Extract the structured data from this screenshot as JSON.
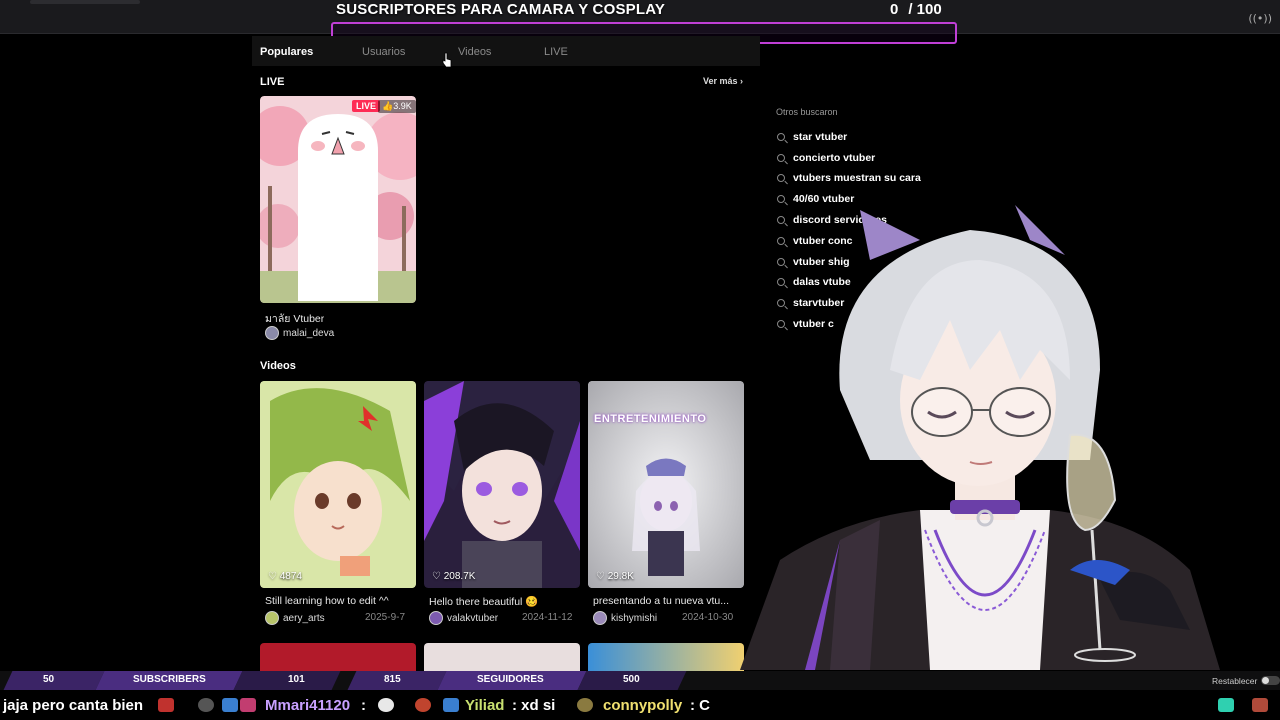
{
  "goal": {
    "title": "SUSCRIPTORES PARA CAMARA Y COSPLAY",
    "current": "0",
    "target": "/ 100",
    "progress": 0,
    "accent": "#c03fd6"
  },
  "tabs": [
    {
      "label": "Populares",
      "active": true
    },
    {
      "label": "Usuarios",
      "active": false
    },
    {
      "label": "Videos",
      "active": false
    },
    {
      "label": "LIVE",
      "active": false
    }
  ],
  "live_section": {
    "title": "LIVE",
    "see_more": "Ver más",
    "card": {
      "badge": "LIVE",
      "likes": "3.9K",
      "caption": "มาลัย Vtuber",
      "author": "malai_deva"
    }
  },
  "videos_section": {
    "title": "Videos",
    "cards": [
      {
        "likes": "4874",
        "caption": "Still learning how to edit ^^",
        "author": "aery_arts",
        "date": "2025-9-7"
      },
      {
        "likes": "208.7K",
        "caption": "Hello there beautiful 🥴",
        "author": "valakvtuber",
        "date": "2024-11-12"
      },
      {
        "likes": "29.8K",
        "caption": "presentando a tu nueva vtu...",
        "author": "kishymishi",
        "date": "2024-10-30",
        "thumb_text": "ENTRETENIMIENTO"
      }
    ]
  },
  "sidebar": {
    "title": "Otros buscaron",
    "items": [
      "star vtuber",
      "concierto vtuber",
      "vtubers muestran su cara",
      "40/60 vtuber",
      "discord servidores",
      "vtuber conc",
      "vtuber shig",
      "dalas vtube",
      "starvtuber",
      "vtuber c"
    ]
  },
  "stats": {
    "subs_left": "50",
    "subs_label": "SUBSCRIBERS",
    "subs_right": "101",
    "follow_left": "815",
    "follow_label": "SEGUIDORES",
    "follow_right": "500",
    "reset": "Restablecer"
  },
  "chat": {
    "msg1": "jaja pero canta bien",
    "name2": "Mmari41120",
    "sep2": ":",
    "name3": "Yiliad",
    "msg3": ": xd si",
    "name4": "connypolly",
    "msg4": ": C"
  }
}
